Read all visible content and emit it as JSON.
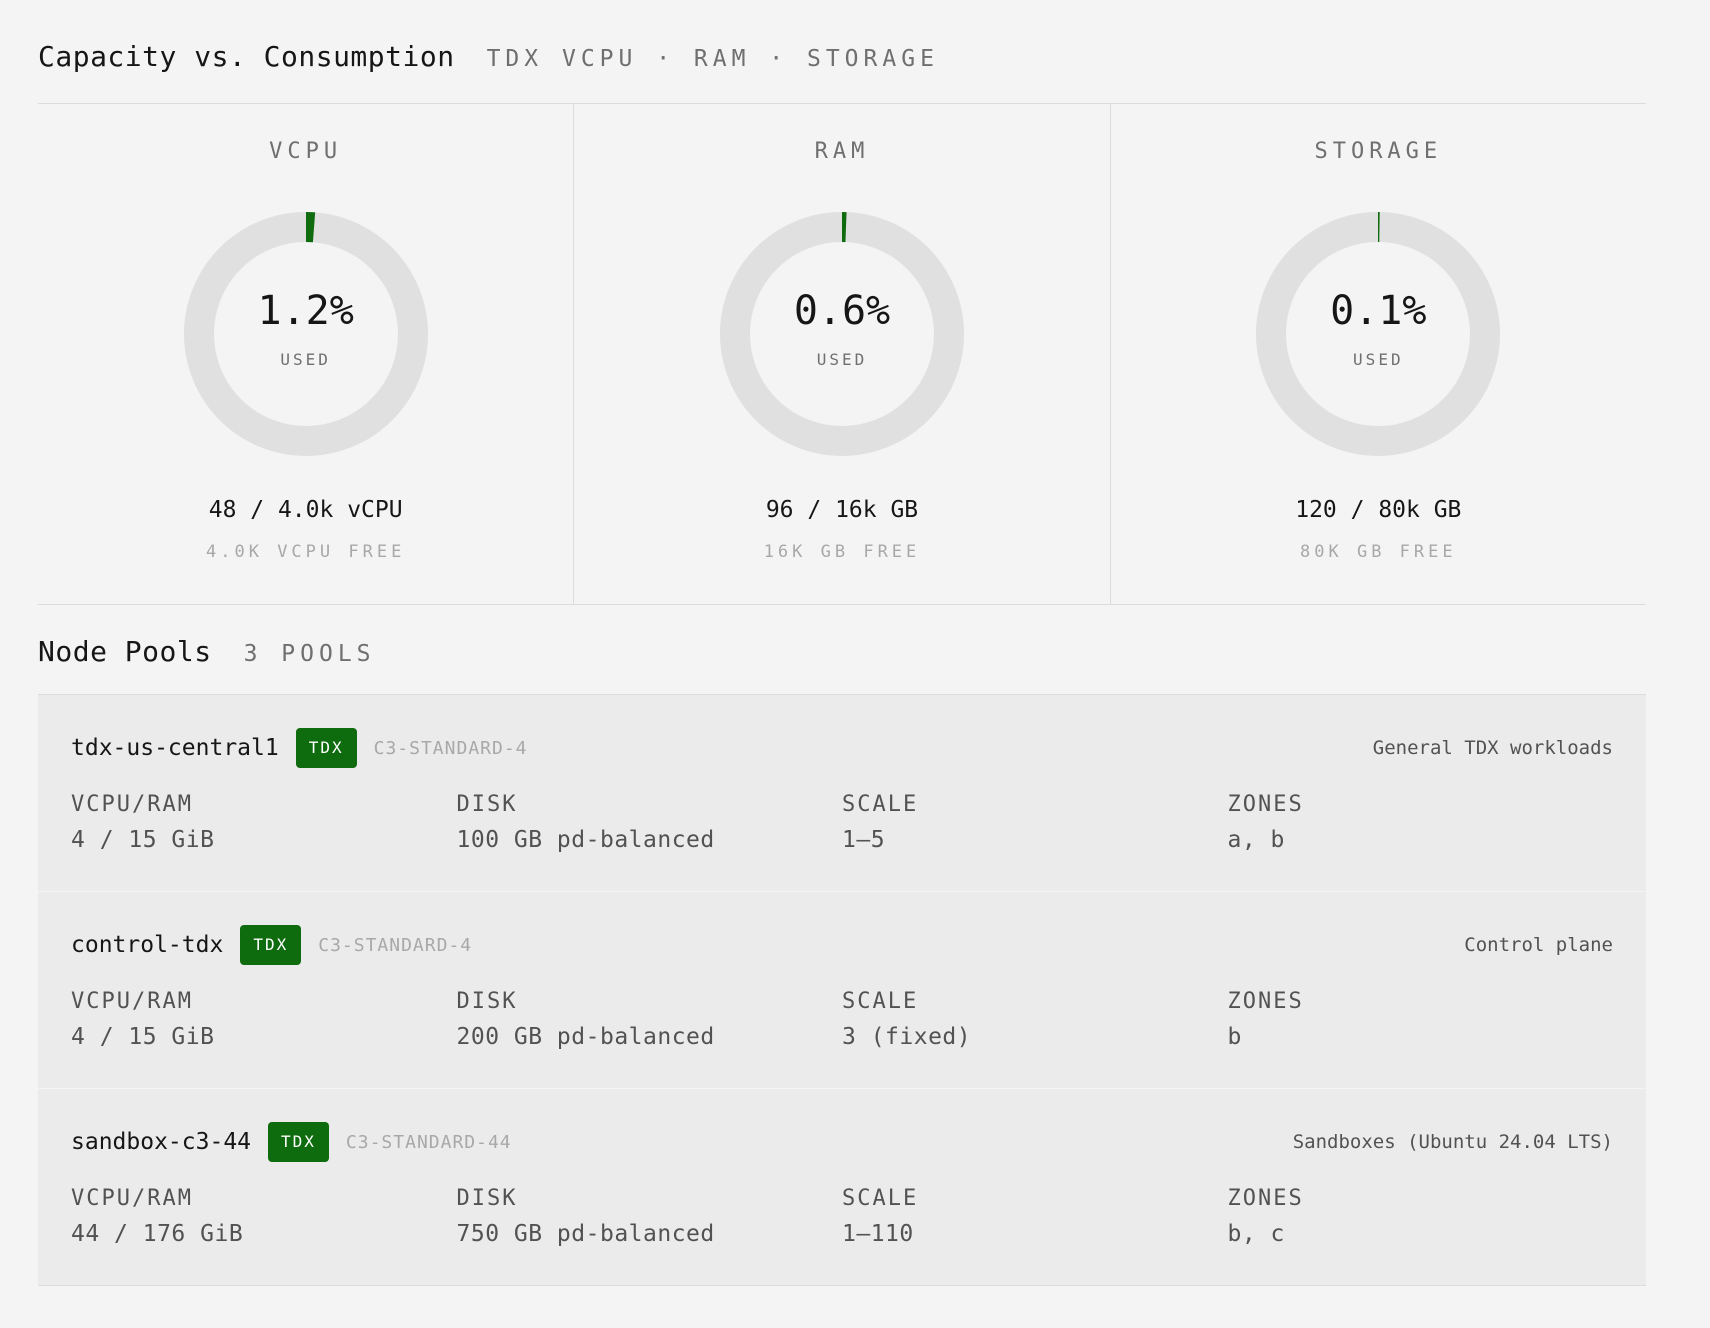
{
  "capacity": {
    "title": "Capacity vs. Consumption",
    "subtitle": "TDX VCPU · RAM · STORAGE",
    "cards": [
      {
        "label": "VCPU",
        "percent": "1.2%",
        "used_fraction": 0.012,
        "used_label": "USED",
        "amount": "48 / 4.0k vCPU",
        "free": "4.0K VCPU FREE"
      },
      {
        "label": "RAM",
        "percent": "0.6%",
        "used_fraction": 0.006,
        "used_label": "USED",
        "amount": "96 / 16k GB",
        "free": "16K GB FREE"
      },
      {
        "label": "STORAGE",
        "percent": "0.1%",
        "used_fraction": 0.0015,
        "used_label": "USED",
        "amount": "120 / 80k GB",
        "free": "80K GB FREE"
      }
    ]
  },
  "pools": {
    "title": "Node Pools",
    "count": "3 POOLS",
    "items": [
      {
        "name": "tdx-us-central1",
        "badge": "TDX",
        "machine": "C3-STANDARD-4",
        "description": "General TDX workloads",
        "cols": [
          {
            "label": "VCPU/RAM",
            "value": "4 / 15 GiB"
          },
          {
            "label": "DISK",
            "value": "100 GB pd-balanced"
          },
          {
            "label": "SCALE",
            "value": "1–5"
          },
          {
            "label": "ZONES",
            "value": "a, b"
          }
        ]
      },
      {
        "name": "control-tdx",
        "badge": "TDX",
        "machine": "C3-STANDARD-4",
        "description": "Control plane",
        "cols": [
          {
            "label": "VCPU/RAM",
            "value": "4 / 15 GiB"
          },
          {
            "label": "DISK",
            "value": "200 GB pd-balanced"
          },
          {
            "label": "SCALE",
            "value": "3 (fixed)"
          },
          {
            "label": "ZONES",
            "value": "b"
          }
        ]
      },
      {
        "name": "sandbox-c3-44",
        "badge": "TDX",
        "machine": "C3-STANDARD-44",
        "description": "Sandboxes (Ubuntu 24.04 LTS)",
        "cols": [
          {
            "label": "VCPU/RAM",
            "value": "44 / 176 GiB"
          },
          {
            "label": "DISK",
            "value": "750 GB pd-balanced"
          },
          {
            "label": "SCALE",
            "value": "1–110"
          },
          {
            "label": "ZONES",
            "value": "b, c"
          }
        ]
      }
    ]
  },
  "colors": {
    "accent": "#0e6b0e",
    "track": "#e0e0e0"
  }
}
